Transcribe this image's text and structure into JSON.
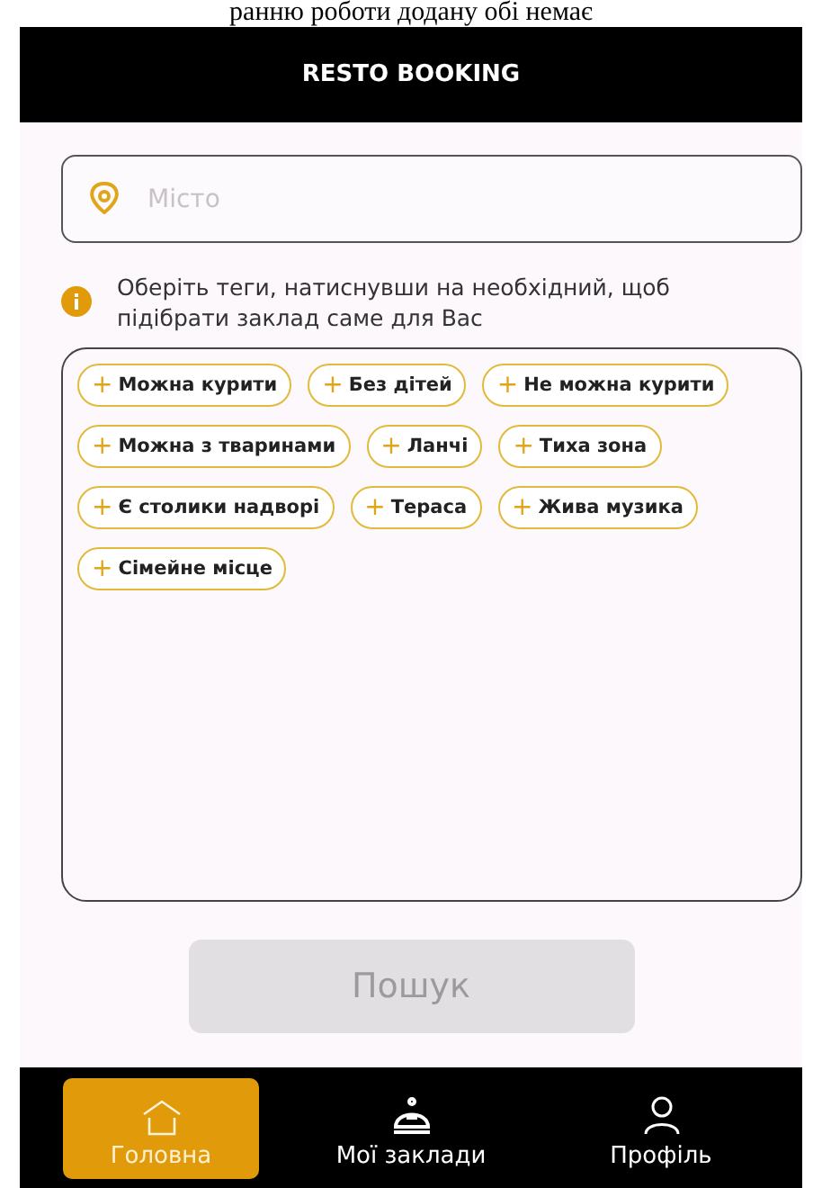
{
  "document_text": "ранню роботи додану обі немає",
  "header": {
    "title": "RESTO BOOKING"
  },
  "city_field": {
    "placeholder": "Місто"
  },
  "hint": "Оберіть теги, натиснувши на необхідний, щоб підібрати заклад саме для Вас",
  "tags": [
    [
      {
        "icon": "+",
        "label": "Можна курити",
        "selected": false
      },
      {
        "icon": "+",
        "label": "Без дітей",
        "selected": false
      },
      {
        "icon": "+",
        "label": "Не можна курити",
        "selected": false
      }
    ],
    [
      {
        "icon": "+",
        "label": "Можна з тваринами",
        "selected": false
      },
      {
        "icon": "+",
        "label": "Ланчі",
        "selected": false
      },
      {
        "icon": "+",
        "label": "Тиха зона",
        "selected": false
      }
    ],
    [
      {
        "icon": "+",
        "label": "Є столики надворі",
        "selected": false
      },
      {
        "icon": "+",
        "label": "Тераса",
        "selected": false
      },
      {
        "icon": "+",
        "label": "Жива музика",
        "selected": false
      }
    ],
    [
      {
        "icon": "+",
        "label": "Сімейне місце",
        "selected": false
      }
    ]
  ],
  "search_button": {
    "label": "Пошук",
    "disabled": true
  },
  "nav": [
    {
      "kind": "home",
      "label": "Головна",
      "selected": true
    },
    {
      "kind": "places",
      "label": "Мої заклади",
      "selected": false
    },
    {
      "kind": "profile",
      "label": "Профіль",
      "selected": false
    }
  ]
}
